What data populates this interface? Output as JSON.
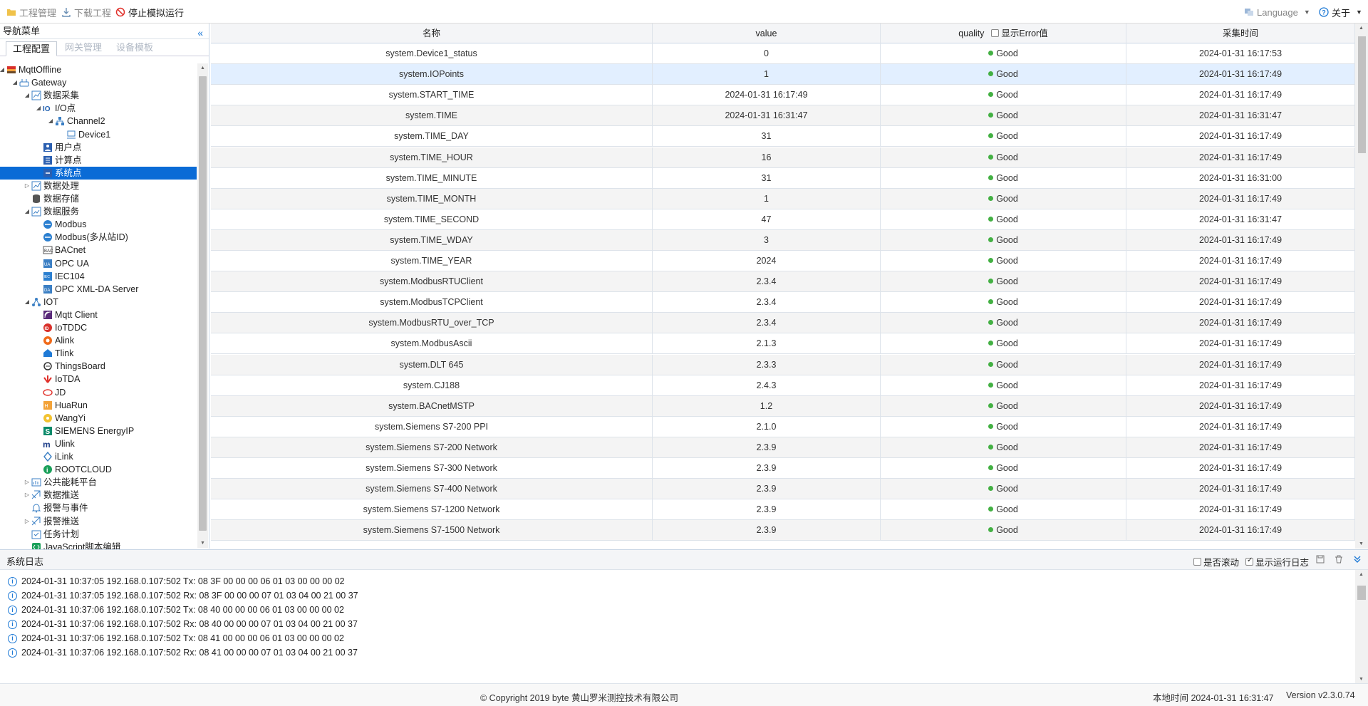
{
  "toolbar": {
    "project_manage": "工程管理",
    "download_project": "下载工程",
    "stop_simulation": "停止模拟运行",
    "language": "Language",
    "about": "关于"
  },
  "sidebar": {
    "title": "导航菜单",
    "tabs": [
      "工程配置",
      "网关管理",
      "设备模板"
    ],
    "tree": [
      {
        "label": "MqttOffline",
        "icon": "project-icon",
        "level": 0,
        "toggle": "open"
      },
      {
        "label": "Gateway",
        "icon": "gateway-icon",
        "level": 1,
        "toggle": "open"
      },
      {
        "label": "数据采集",
        "icon": "chart-icon",
        "level": 2,
        "toggle": "open"
      },
      {
        "label": "I/O点",
        "icon": "io-icon",
        "level": 3,
        "toggle": "open"
      },
      {
        "label": "Channel2",
        "icon": "channel-icon",
        "level": 4,
        "toggle": "open"
      },
      {
        "label": "Device1",
        "icon": "device-icon",
        "level": 5,
        "toggle": "none"
      },
      {
        "label": "用户点",
        "icon": "user-point-icon",
        "level": 3,
        "toggle": "none"
      },
      {
        "label": "计算点",
        "icon": "calc-point-icon",
        "level": 3,
        "toggle": "none"
      },
      {
        "label": "系统点",
        "icon": "system-point-icon",
        "level": 3,
        "toggle": "none",
        "selected": true
      },
      {
        "label": "数据处理",
        "icon": "chart-icon",
        "level": 2,
        "toggle": "closed"
      },
      {
        "label": "数据存储",
        "icon": "database-icon",
        "level": 2,
        "toggle": "none"
      },
      {
        "label": "数据服务",
        "icon": "service-icon",
        "level": 2,
        "toggle": "open"
      },
      {
        "label": "Modbus",
        "icon": "modbus-icon",
        "level": 3,
        "toggle": "none"
      },
      {
        "label": "Modbus(多从站ID)",
        "icon": "modbus-icon",
        "level": 3,
        "toggle": "none"
      },
      {
        "label": "BACnet",
        "icon": "bacnet-icon",
        "level": 3,
        "toggle": "none"
      },
      {
        "label": "OPC UA",
        "icon": "opcua-icon",
        "level": 3,
        "toggle": "none"
      },
      {
        "label": "IEC104",
        "icon": "iec104-icon",
        "level": 3,
        "toggle": "none"
      },
      {
        "label": "OPC XML-DA Server",
        "icon": "opcxml-icon",
        "level": 3,
        "toggle": "none"
      },
      {
        "label": "IOT",
        "icon": "iot-icon",
        "level": 2,
        "toggle": "open"
      },
      {
        "label": "Mqtt Client",
        "icon": "mqtt-icon",
        "level": 3,
        "toggle": "none"
      },
      {
        "label": "IoTDDC",
        "icon": "iotddc-icon",
        "level": 3,
        "toggle": "none"
      },
      {
        "label": "Alink",
        "icon": "alink-icon",
        "level": 3,
        "toggle": "none"
      },
      {
        "label": "Tlink",
        "icon": "tlink-icon",
        "level": 3,
        "toggle": "none"
      },
      {
        "label": "ThingsBoard",
        "icon": "thingsboard-icon",
        "level": 3,
        "toggle": "none"
      },
      {
        "label": "IoTDA",
        "icon": "huawei-icon",
        "level": 3,
        "toggle": "none"
      },
      {
        "label": "JD",
        "icon": "jd-icon",
        "level": 3,
        "toggle": "none"
      },
      {
        "label": "HuaRun",
        "icon": "huarun-icon",
        "level": 3,
        "toggle": "none"
      },
      {
        "label": "WangYi",
        "icon": "wangyi-icon",
        "level": 3,
        "toggle": "none"
      },
      {
        "label": "SIEMENS EnergyIP",
        "icon": "siemens-icon",
        "level": 3,
        "toggle": "none"
      },
      {
        "label": "Ulink",
        "icon": "ulink-icon",
        "level": 3,
        "toggle": "none"
      },
      {
        "label": "iLink",
        "icon": "ilink-icon",
        "level": 3,
        "toggle": "none"
      },
      {
        "label": "ROOTCLOUD",
        "icon": "rootcloud-icon",
        "level": 3,
        "toggle": "none"
      },
      {
        "label": "公共能耗平台",
        "icon": "platform-icon",
        "level": 2,
        "toggle": "closed"
      },
      {
        "label": "数据推送",
        "icon": "push-icon",
        "level": 2,
        "toggle": "closed"
      },
      {
        "label": "报警与事件",
        "icon": "bell-icon",
        "level": 2,
        "toggle": "none"
      },
      {
        "label": "报警推送",
        "icon": "push-icon",
        "level": 2,
        "toggle": "closed"
      },
      {
        "label": "任务计划",
        "icon": "task-icon",
        "level": 2,
        "toggle": "none"
      },
      {
        "label": "JavaScript脚本编辑",
        "icon": "script-icon",
        "level": 2,
        "toggle": "none"
      }
    ]
  },
  "grid": {
    "headers": {
      "name": "名称",
      "value": "value",
      "quality": "quality",
      "show_error": "显示Error值",
      "time": "采集时间"
    },
    "rows": [
      {
        "name": "system.Device1_status",
        "value": "0",
        "quality": "Good",
        "time": "2024-01-31 16:17:53"
      },
      {
        "name": "system.IOPoints",
        "value": "1",
        "quality": "Good",
        "time": "2024-01-31 16:17:49"
      },
      {
        "name": "system.START_TIME",
        "value": "2024-01-31 16:17:49",
        "quality": "Good",
        "time": "2024-01-31 16:17:49"
      },
      {
        "name": "system.TIME",
        "value": "2024-01-31 16:31:47",
        "quality": "Good",
        "time": "2024-01-31 16:31:47"
      },
      {
        "name": "system.TIME_DAY",
        "value": "31",
        "quality": "Good",
        "time": "2024-01-31 16:17:49"
      },
      {
        "name": "system.TIME_HOUR",
        "value": "16",
        "quality": "Good",
        "time": "2024-01-31 16:17:49"
      },
      {
        "name": "system.TIME_MINUTE",
        "value": "31",
        "quality": "Good",
        "time": "2024-01-31 16:31:00"
      },
      {
        "name": "system.TIME_MONTH",
        "value": "1",
        "quality": "Good",
        "time": "2024-01-31 16:17:49"
      },
      {
        "name": "system.TIME_SECOND",
        "value": "47",
        "quality": "Good",
        "time": "2024-01-31 16:31:47"
      },
      {
        "name": "system.TIME_WDAY",
        "value": "3",
        "quality": "Good",
        "time": "2024-01-31 16:17:49"
      },
      {
        "name": "system.TIME_YEAR",
        "value": "2024",
        "quality": "Good",
        "time": "2024-01-31 16:17:49"
      },
      {
        "name": "system.ModbusRTUClient",
        "value": "2.3.4",
        "quality": "Good",
        "time": "2024-01-31 16:17:49"
      },
      {
        "name": "system.ModbusTCPClient",
        "value": "2.3.4",
        "quality": "Good",
        "time": "2024-01-31 16:17:49"
      },
      {
        "name": "system.ModbusRTU_over_TCP",
        "value": "2.3.4",
        "quality": "Good",
        "time": "2024-01-31 16:17:49"
      },
      {
        "name": "system.ModbusAscii",
        "value": "2.1.3",
        "quality": "Good",
        "time": "2024-01-31 16:17:49"
      },
      {
        "name": "system.DLT 645",
        "value": "2.3.3",
        "quality": "Good",
        "time": "2024-01-31 16:17:49"
      },
      {
        "name": "system.CJ188",
        "value": "2.4.3",
        "quality": "Good",
        "time": "2024-01-31 16:17:49"
      },
      {
        "name": "system.BACnetMSTP",
        "value": "1.2",
        "quality": "Good",
        "time": "2024-01-31 16:17:49"
      },
      {
        "name": "system.Siemens S7-200 PPI",
        "value": "2.1.0",
        "quality": "Good",
        "time": "2024-01-31 16:17:49"
      },
      {
        "name": "system.Siemens S7-200 Network",
        "value": "2.3.9",
        "quality": "Good",
        "time": "2024-01-31 16:17:49"
      },
      {
        "name": "system.Siemens S7-300 Network",
        "value": "2.3.9",
        "quality": "Good",
        "time": "2024-01-31 16:17:49"
      },
      {
        "name": "system.Siemens S7-400 Network",
        "value": "2.3.9",
        "quality": "Good",
        "time": "2024-01-31 16:17:49"
      },
      {
        "name": "system.Siemens S7-1200 Network",
        "value": "2.3.9",
        "quality": "Good",
        "time": "2024-01-31 16:17:49"
      },
      {
        "name": "system.Siemens S7-1500 Network",
        "value": "2.3.9",
        "quality": "Good",
        "time": "2024-01-31 16:17:49"
      }
    ],
    "highlighted_row": 1
  },
  "log": {
    "title": "系统日志",
    "auto_scroll": "是否滚动",
    "show_run_log": "显示运行日志",
    "lines": [
      "2024-01-31 10:37:05 192.168.0.107:502 Tx: 08 3F 00 00 00 06 01 03 00 00 00 02",
      "2024-01-31 10:37:05 192.168.0.107:502 Rx: 08 3F 00 00 00 07 01 03 04 00 21 00 37",
      "2024-01-31 10:37:06 192.168.0.107:502 Tx: 08 40 00 00 00 06 01 03 00 00 00 02",
      "2024-01-31 10:37:06 192.168.0.107:502 Rx: 08 40 00 00 00 07 01 03 04 00 21 00 37",
      "2024-01-31 10:37:06 192.168.0.107:502 Tx: 08 41 00 00 00 06 01 03 00 00 00 02",
      "2024-01-31 10:37:06 192.168.0.107:502 Rx: 08 41 00 00 00 07 01 03 04 00 21 00 37"
    ]
  },
  "footer": {
    "copyright": "© Copyright 2019 byte 黄山罗米测控技术有限公司",
    "local_time": "本地时间 2024-01-31 16:31:47",
    "version": "Version v2.3.0.74"
  },
  "colors": {
    "accent": "#0a6bd6",
    "good": "#43b043"
  }
}
